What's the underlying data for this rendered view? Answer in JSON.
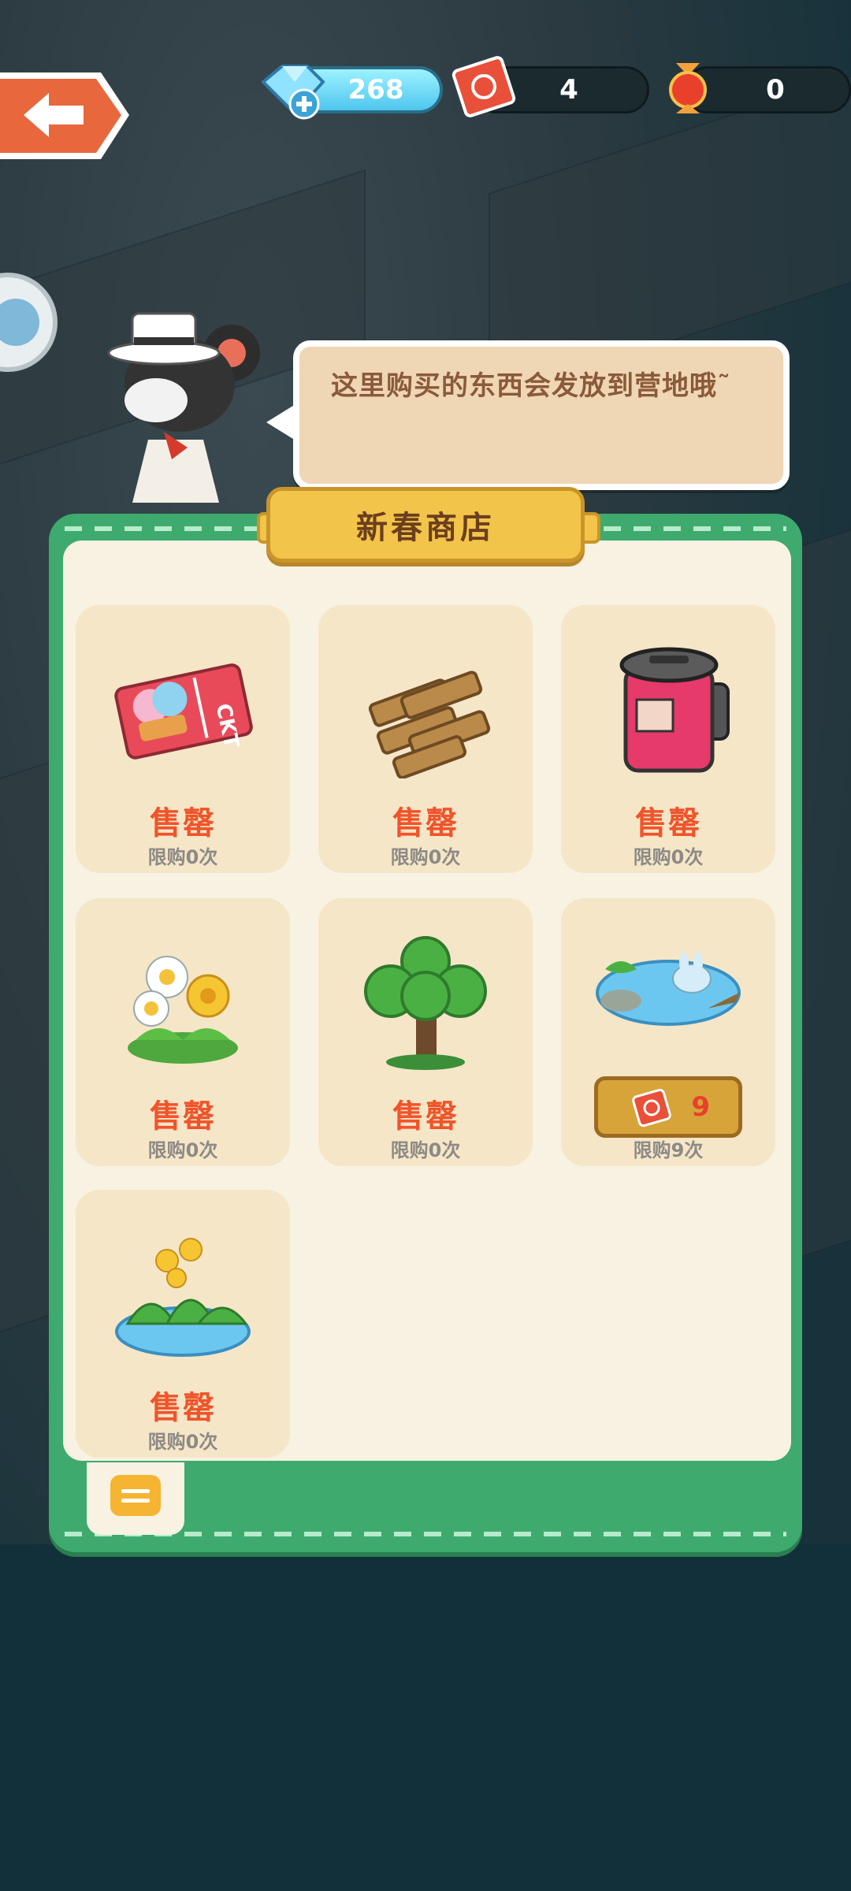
{
  "currencies": {
    "diamond": {
      "value": "268",
      "icon": "diamond-icon",
      "plus_icon": "plus-icon"
    },
    "ticket": {
      "value": "4",
      "icon": "red-ticket-icon"
    },
    "candy": {
      "value": "0",
      "icon": "candy-icon"
    }
  },
  "speech": {
    "text": "这里购买的东西会发放到营地哦˜"
  },
  "shop": {
    "title": "新春商店",
    "items": [
      {
        "name": "售罄",
        "limit": "限购0次",
        "icon": "ticket-item-icon"
      },
      {
        "name": "售罄",
        "limit": "限购0次",
        "icon": "wood-logs-icon"
      },
      {
        "name": "售罄",
        "limit": "限购0次",
        "icon": "jar-icon"
      },
      {
        "name": "售罄",
        "limit": "限购0次",
        "icon": "daisy-flowers-icon"
      },
      {
        "name": "售罄",
        "limit": "限购0次",
        "icon": "tree-icon"
      },
      {
        "name": "",
        "limit": "限购9次",
        "icon": "pond-icon",
        "price": "9",
        "price_icon": "red-ticket-icon"
      },
      {
        "name": "售罄",
        "limit": "限购0次",
        "icon": "yellow-flower-pond-icon"
      }
    ]
  },
  "colors": {
    "panel_green": "#3faa6e",
    "sold_out_red": "#f0542a",
    "back_orange": "#e8673d"
  }
}
